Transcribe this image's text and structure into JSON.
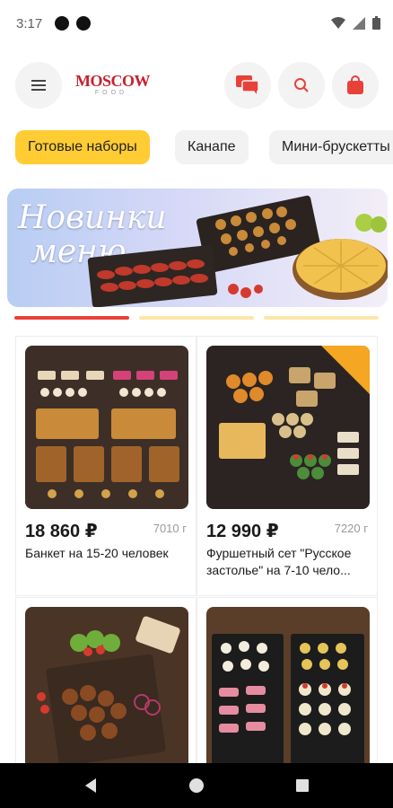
{
  "status_bar": {
    "time": "3:17"
  },
  "header": {
    "logo_text": "MOSCOW",
    "logo_subtext": "FOOD",
    "icons": [
      "menu-icon",
      "chat-icon",
      "search-icon",
      "bag-icon"
    ]
  },
  "categories": [
    {
      "label": "Готовые наборы",
      "active": true
    },
    {
      "label": "Канапе",
      "active": false
    },
    {
      "label": "Мини-брускетты",
      "active": false
    }
  ],
  "banner": {
    "title_line1": "Новинки",
    "title_line2": "меню"
  },
  "banner_pager": {
    "count": 3,
    "active_index": 0
  },
  "products": [
    {
      "price": "18 860 ₽",
      "weight": "7010 г",
      "title": "Банкет на 15-20 человек"
    },
    {
      "price": "12 990 ₽",
      "weight": "7220 г",
      "title": "Фуршетный сет \"Русское застолье\" на 7-10 чело..."
    },
    {
      "price": "",
      "weight": "",
      "title": ""
    },
    {
      "price": "",
      "weight": "",
      "title": ""
    }
  ],
  "colors": {
    "accent": "#e8413a",
    "chip_active": "#ffcc33",
    "pager_inactive": "#fde7a8"
  }
}
